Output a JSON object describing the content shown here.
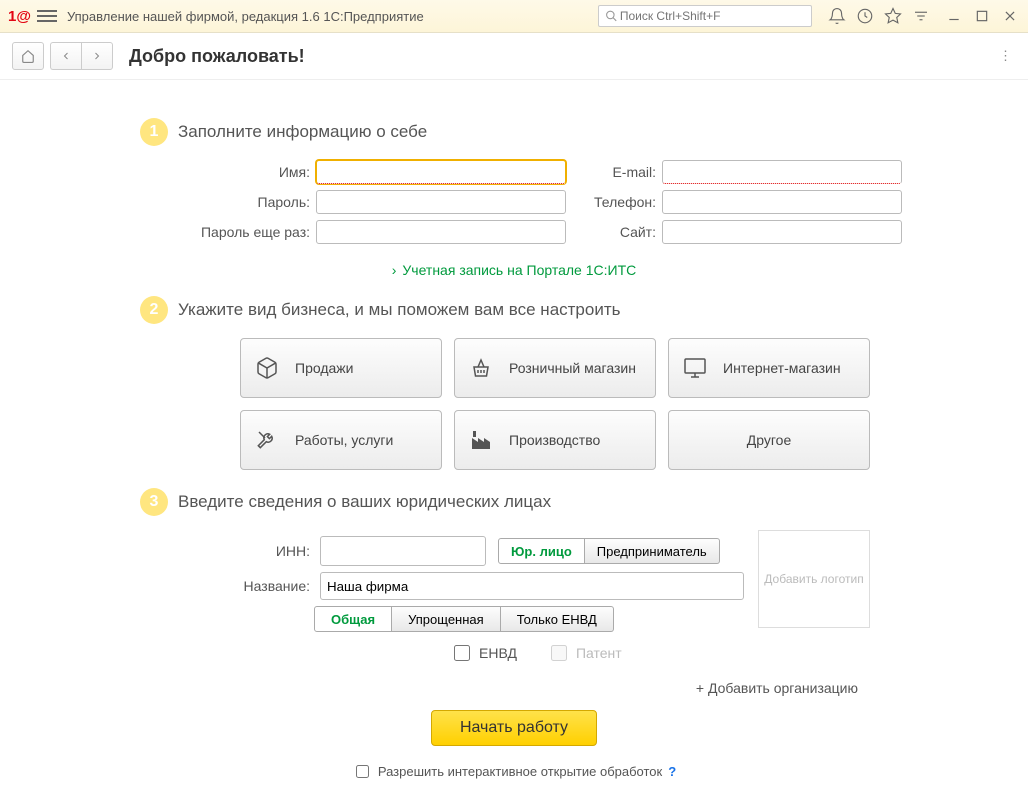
{
  "titlebar": {
    "app_title": "Управление нашей фирмой, редакция 1.6 1С:Предприятие",
    "search_placeholder": "Поиск Ctrl+Shift+F",
    "logo": "1@"
  },
  "toolbar": {
    "page_title": "Добро пожаловать!"
  },
  "step1": {
    "num": "1",
    "title": "Заполните информацию о себе",
    "labels": {
      "name": "Имя:",
      "email": "E-mail:",
      "password": "Пароль:",
      "phone": "Телефон:",
      "password2": "Пароль еще раз:",
      "site": "Сайт:"
    },
    "portal_link": "Учетная запись на Портале 1С:ИТС"
  },
  "step2": {
    "num": "2",
    "title": "Укажите вид бизнеса, и мы поможем вам все настроить",
    "cards": [
      "Продажи",
      "Розничный магазин",
      "Интернет-магазин",
      "Работы, услуги",
      "Производство",
      "Другое"
    ]
  },
  "step3": {
    "num": "3",
    "title": "Введите сведения о ваших юридических лицах",
    "labels": {
      "inn": "ИНН:",
      "name": "Название:"
    },
    "entity_type": [
      "Юр. лицо",
      "Предприниматель"
    ],
    "company_name": "Наша фирма",
    "tax": [
      "Общая",
      "Упрощенная",
      "Только ЕНВД"
    ],
    "checks": {
      "envd": "ЕНВД",
      "patent": "Патент"
    },
    "logo_placeholder": "Добавить логотип",
    "add_org": "+ Добавить организацию"
  },
  "footer": {
    "start": "Начать работу",
    "permission": "Разрешить интерактивное открытие обработок",
    "help": "?"
  }
}
